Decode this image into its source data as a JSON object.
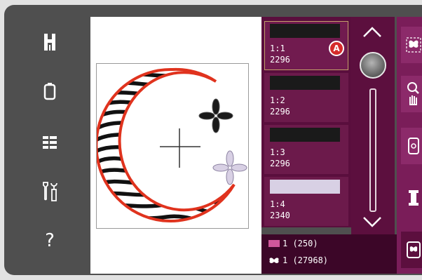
{
  "left_toolbar": {
    "items": [
      {
        "icon": "presser-foot-icon"
      },
      {
        "icon": "hoop-frame-icon"
      },
      {
        "icon": "list-view-icon"
      },
      {
        "icon": "settings-tools-icon"
      },
      {
        "icon": "help-icon",
        "glyph": "?"
      }
    ]
  },
  "color_blocks": [
    {
      "name": "1:1",
      "count": "2296",
      "swatch_color": "#1a1a1a",
      "selected": true,
      "badge": "A"
    },
    {
      "name": "1:2",
      "count": "2296",
      "swatch_color": "#1a1a1a",
      "selected": false
    },
    {
      "name": "1:3",
      "count": "2296",
      "swatch_color": "#1a1a1a",
      "selected": false
    },
    {
      "name": "1:4",
      "count": "2340",
      "swatch_color": "#d8d0e4",
      "selected": false
    }
  ],
  "summary": {
    "color_changes": "1 (250)",
    "stitches": "1 (27968)",
    "color_chip": "#d0579b"
  },
  "colors": {
    "accent": "#7a1d59",
    "panel": "#5a0e3d",
    "hoop_ring": "#e0331e"
  }
}
